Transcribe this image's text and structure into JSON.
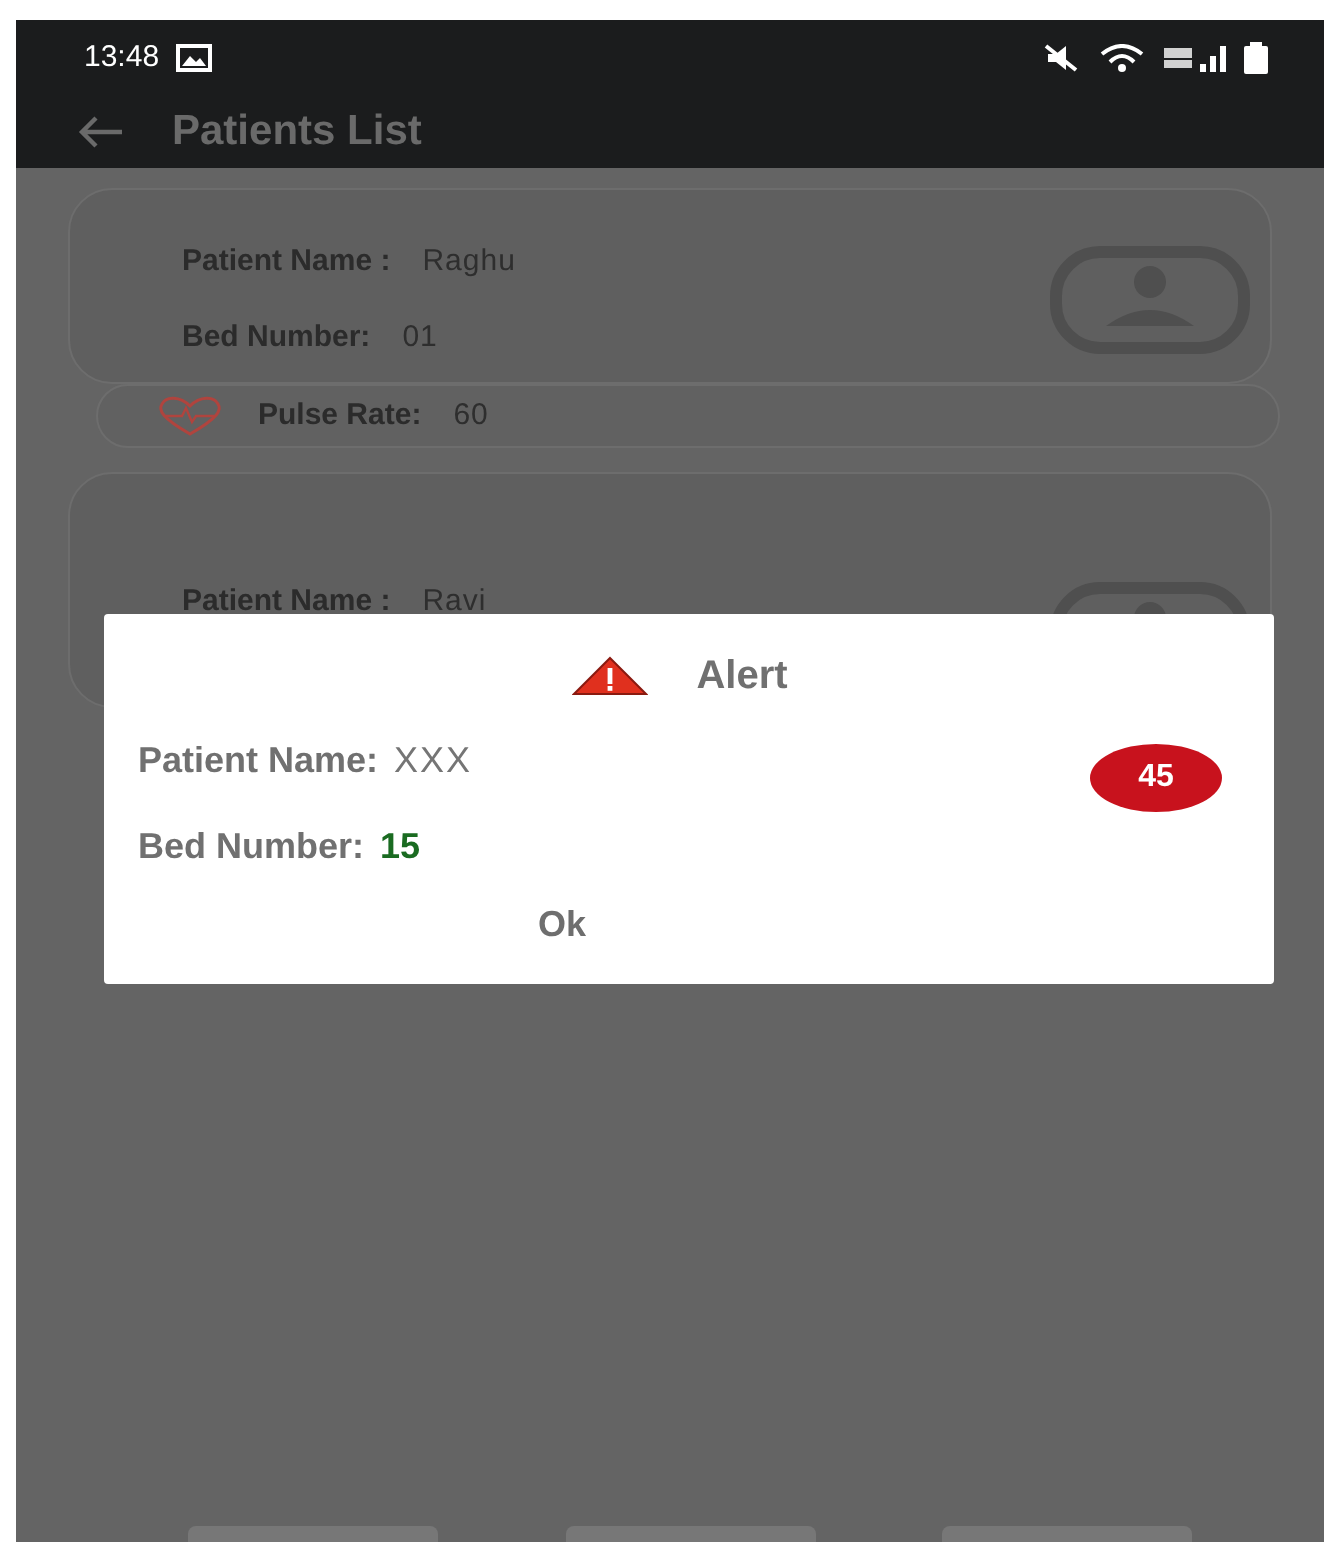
{
  "status_bar": {
    "time": "13:48"
  },
  "app_bar": {
    "title": "Patients List"
  },
  "patients": [
    {
      "name_label": "Patient Name :",
      "name": "Raghu",
      "bed_label": "Bed Number:",
      "bed": "01",
      "pulse_label": "Pulse Rate:",
      "pulse": "60"
    },
    {
      "name_label": "Patient Name :",
      "name": "Ravi"
    }
  ],
  "alert": {
    "title": "Alert",
    "name_label": "Patient Name:",
    "name": "XXX",
    "bed_label": "Bed Number:",
    "bed": "15",
    "value_badge": "45",
    "button": "Ok"
  }
}
